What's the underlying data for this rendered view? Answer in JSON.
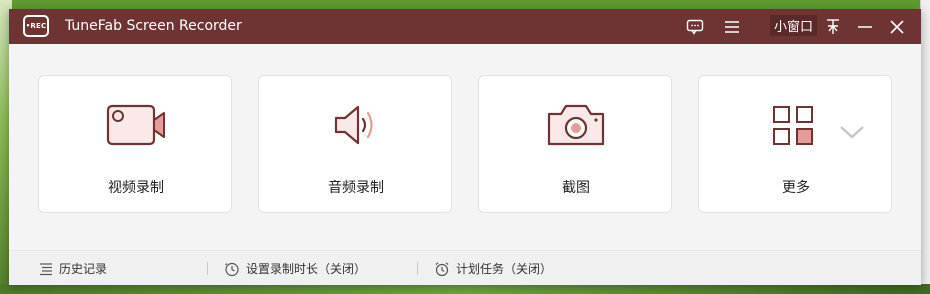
{
  "window": {
    "title": "TuneFab Screen Recorder",
    "logo_text": "•REC",
    "mini_window_label": "小窗口",
    "accent_color": "#6e3434"
  },
  "titlebar_icons": [
    "chat-icon",
    "menu-icon",
    "pin-icon",
    "minimize-icon",
    "close-icon"
  ],
  "cards": [
    {
      "label": "视频录制",
      "icon": "video-camera-icon"
    },
    {
      "label": "音频录制",
      "icon": "speaker-icon"
    },
    {
      "label": "截图",
      "icon": "camera-icon"
    },
    {
      "label": "更多",
      "icon": "grid-icon"
    }
  ],
  "footer": {
    "history": "历史记录",
    "timer": "设置录制时长（关闭）",
    "schedule": "计划任务（关闭）"
  }
}
